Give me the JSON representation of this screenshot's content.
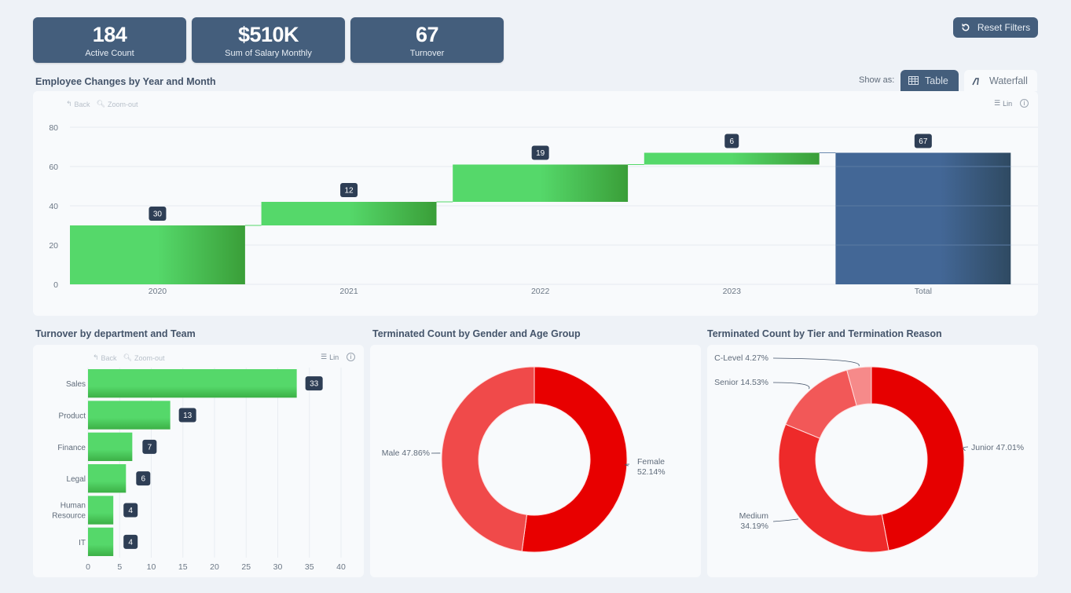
{
  "kpis": [
    {
      "value": "184",
      "label": "Active Count"
    },
    {
      "value": "$510K",
      "label": "Sum of Salary Monthly"
    },
    {
      "value": "67",
      "label": "Turnover"
    }
  ],
  "reset_button": {
    "label": "Reset Filters",
    "icon": "reset-icon"
  },
  "waterfall_section": {
    "title": "Employee Changes by Year and Month",
    "show_as_label": "Show as:",
    "tabs": [
      {
        "label": "Table",
        "icon": "table-icon",
        "active": true
      },
      {
        "label": "Waterfall",
        "icon": "waterfall-icon",
        "active": false
      }
    ],
    "toolbar": {
      "back": "Back",
      "zoom_out": "Zoom-out",
      "scale": "Lin"
    }
  },
  "dept_section": {
    "title": "Turnover by department and Team",
    "toolbar": {
      "back": "Back",
      "zoom_out": "Zoom-out",
      "scale": "Lin"
    }
  },
  "gender_section": {
    "title": "Terminated Count by Gender and Age Group"
  },
  "tier_section": {
    "title": "Terminated Count by Tier and Termination Reason"
  },
  "colors": {
    "kpi_bg": "#445e7c",
    "green": "#55d86a",
    "green_dark": "#3a9e38",
    "total_blue": "#436796",
    "total_blue_dark": "#2f4a62",
    "label_badge": "#2e3e55",
    "red": "#ee0000",
    "red_light": "#f26565"
  },
  "chart_data": [
    {
      "type": "waterfall",
      "title": "Employee Changes by Year and Month",
      "categories": [
        "2020",
        "2021",
        "2022",
        "2023",
        "Total"
      ],
      "values": [
        30,
        12,
        19,
        6,
        67
      ],
      "is_total": [
        false,
        false,
        false,
        false,
        true
      ],
      "yticks": [
        0,
        20,
        40,
        60,
        80
      ],
      "ylim": [
        0,
        80
      ],
      "grid": true
    },
    {
      "type": "bar",
      "orientation": "horizontal",
      "title": "Turnover by department and Team",
      "categories": [
        "Sales",
        "Product",
        "Finance",
        "Legal",
        "Human Resource",
        "IT"
      ],
      "values": [
        33,
        13,
        7,
        6,
        4,
        4
      ],
      "xticks": [
        0,
        5,
        10,
        15,
        20,
        25,
        30,
        35,
        40
      ],
      "xlim": [
        0,
        40
      ],
      "grid": true
    },
    {
      "type": "pie",
      "subtype": "donut",
      "title": "Terminated Count by Gender and Age Group",
      "slices": [
        {
          "label": "Female",
          "percent": 52.14,
          "display": "Female 52.14%"
        },
        {
          "label": "Male",
          "percent": 47.86,
          "display": "Male 47.86%"
        }
      ]
    },
    {
      "type": "pie",
      "subtype": "donut",
      "title": "Terminated Count by Tier and Termination Reason",
      "slices": [
        {
          "label": "Junior",
          "percent": 47.01,
          "display": "Junior 47.01%"
        },
        {
          "label": "Medium",
          "percent": 34.19,
          "display": "Medium 34.19%"
        },
        {
          "label": "Senior",
          "percent": 14.53,
          "display": "Senior 14.53%"
        },
        {
          "label": "C-Level",
          "percent": 4.27,
          "display": "C-Level 4.27%"
        }
      ]
    }
  ]
}
